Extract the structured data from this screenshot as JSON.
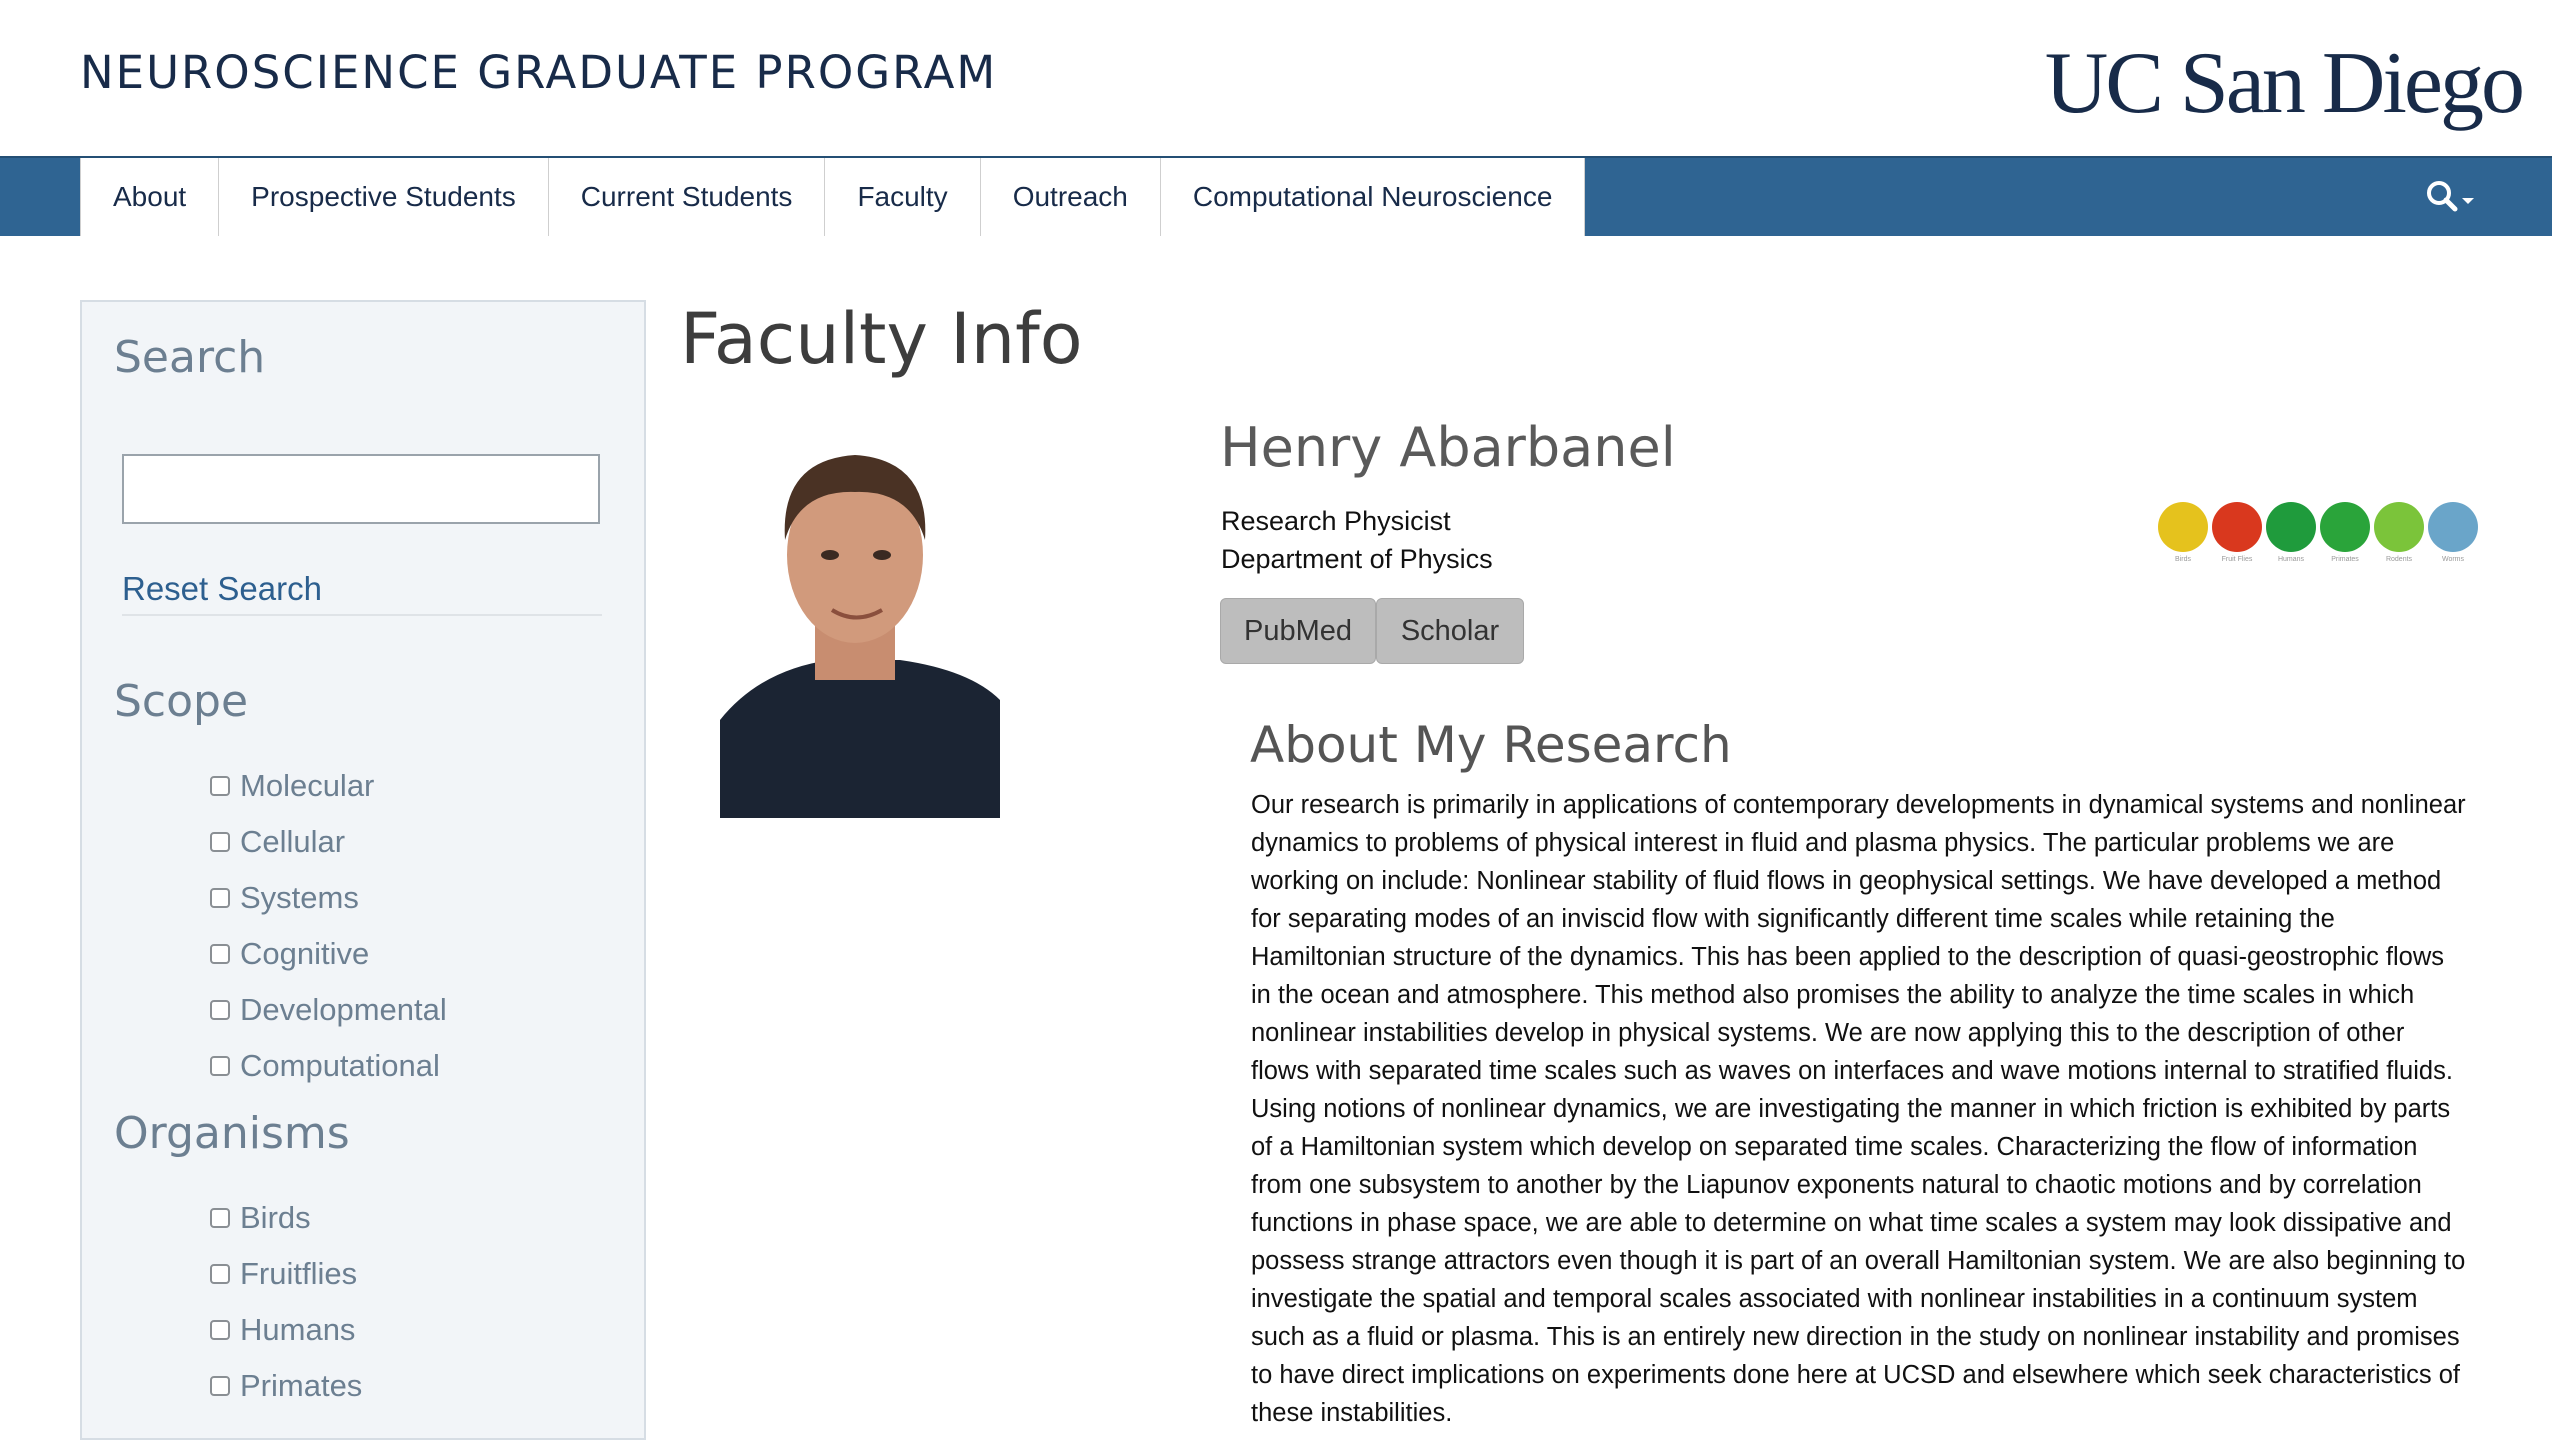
{
  "header": {
    "program_title": "NEUROSCIENCE GRADUATE PROGRAM",
    "logo_text": "UC San Diego"
  },
  "nav": {
    "items": [
      {
        "label": "About"
      },
      {
        "label": "Prospective Students"
      },
      {
        "label": "Current Students"
      },
      {
        "label": "Faculty"
      },
      {
        "label": "Outreach"
      },
      {
        "label": "Computational Neuroscience"
      }
    ],
    "search_icon": "search-icon"
  },
  "sidebar": {
    "search_heading": "Search",
    "search_value": "",
    "reset_label": "Reset Search",
    "scope_heading": "Scope",
    "scope_items": [
      "Molecular",
      "Cellular",
      "Systems",
      "Cognitive",
      "Developmental",
      "Computational"
    ],
    "organisms_heading": "Organisms",
    "organism_items": [
      "Birds",
      "Fruitflies",
      "Humans",
      "Primates"
    ]
  },
  "main": {
    "page_title": "Faculty Info",
    "name": "Henry Abarbanel",
    "title": "Research Physicist",
    "department": "Department of Physics",
    "buttons": {
      "pubmed": "PubMed",
      "scholar": "Scholar"
    },
    "organism_icons": [
      {
        "name": "bird-icon",
        "caption": "Birds",
        "color": "#e5c21d"
      },
      {
        "name": "fruitfly-icon",
        "caption": "Fruit Flies",
        "color": "#d9381e"
      },
      {
        "name": "human-icon",
        "caption": "Humans",
        "color": "#1f9b3c"
      },
      {
        "name": "primate-icon",
        "caption": "Primates",
        "color": "#2aa43a"
      },
      {
        "name": "rodent-icon",
        "caption": "Rodents",
        "color": "#7bc43a"
      },
      {
        "name": "worm-icon",
        "caption": "Worms",
        "color": "#6aa5c9"
      }
    ],
    "research_heading": "About My Research",
    "research_text": "Our research is primarily in applications of contemporary developments in dynamical systems and nonlinear dynamics to problems of physical interest in fluid and plasma physics. The particular problems we are working on include: Nonlinear stability of fluid flows in geophysical settings. We have developed a method for separating modes of an inviscid flow with significantly different time scales while retaining the Hamiltonian structure of the dynamics. This has been applied to the description of quasi-geostrophic flows in the ocean and atmosphere. This method also promises the ability to analyze the time scales in which nonlinear instabilities develop in physical systems. We are now applying this to the description of other flows with separated time scales such as waves on interfaces and wave motions internal to stratified fluids. Using notions of nonlinear dynamics, we are investigating the manner in which friction is exhibited by parts of a Hamiltonian system which develop on separated time scales. Characterizing the flow of information from one subsystem to another by the Liapunov exponents natural to chaotic motions and by correlation functions in phase space, we are able to determine on what time scales a system may look dissipative and possess strange attractors even though it is part of an overall Hamiltonian system. We are also beginning to investigate the spatial and temporal scales associated with nonlinear instabilities in a continuum system such as a fluid or plasma. This is an entirely new direction in the study on nonlinear instability and promises to have direct implications on experiments done here at UCSD and elsewhere which seek characteristics of these instabilities."
  }
}
